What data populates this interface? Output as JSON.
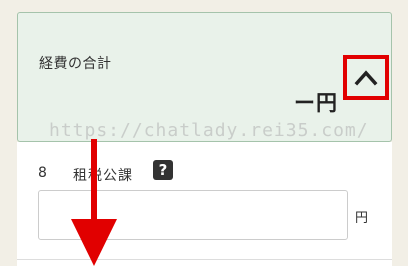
{
  "summary": {
    "title": "経費の合計",
    "value": "ー円",
    "toggle_icon": "chevron-up-icon"
  },
  "watermark": "https://chatlady.rei35.com/",
  "field": {
    "number": "8",
    "label": "租税公課",
    "help_icon_text": "?",
    "input_value": "",
    "unit": "円"
  },
  "colors": {
    "panel_background": "#e9f2ea",
    "panel_border": "#a5c3ab",
    "highlight": "#e10000",
    "page_background": "#f2efe6"
  }
}
